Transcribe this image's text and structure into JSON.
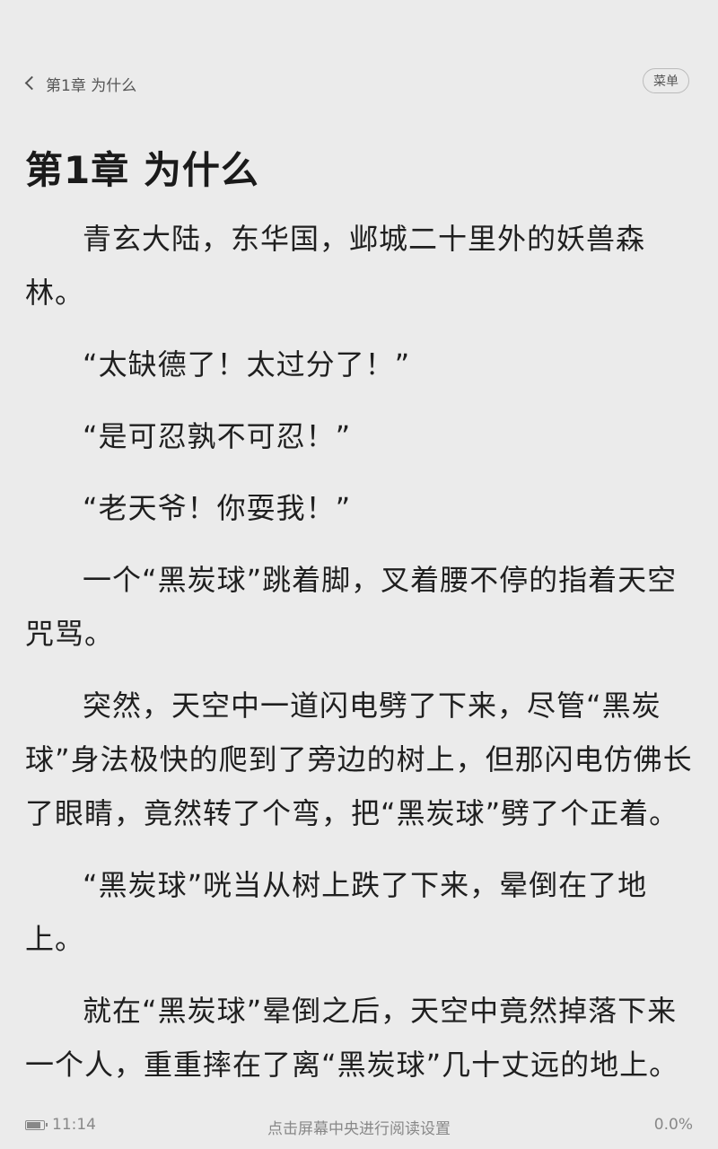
{
  "header": {
    "back_title": "第1章 为什么",
    "menu_label": "菜单"
  },
  "chapter": {
    "title": "第1章 为什么",
    "paragraphs": [
      "青玄大陆，东华国，邺城二十里外的妖兽森林。",
      "“太缺德了！太过分了！”",
      "“是可忍孰不可忍！”",
      "“老天爷！你耍我！”",
      "一个“黑炭球”跳着脚，叉着腰不停的指着天空咒骂。",
      "突然，天空中一道闪电劈了下来，尽管“黑炭球”身法极快的爬到了旁边的树上，但那闪电仿佛长了眼睛，竟然转了个弯，把“黑炭球”劈了个正着。",
      "“黑炭球”咣当从树上跌了下来，晕倒在了地上。",
      "就在“黑炭球”晕倒之后，天空中竟然掉落下来一个人，重重摔在了离“黑炭球”几十丈远的地上。"
    ]
  },
  "footer": {
    "time": "11:14",
    "hint": "点击屏幕中央进行阅读设置",
    "progress_text": "0.0%",
    "battery_level": 0.9
  },
  "colors": {
    "background": "#ebebeb",
    "text": "#1f1f1f",
    "muted": "#888888"
  }
}
